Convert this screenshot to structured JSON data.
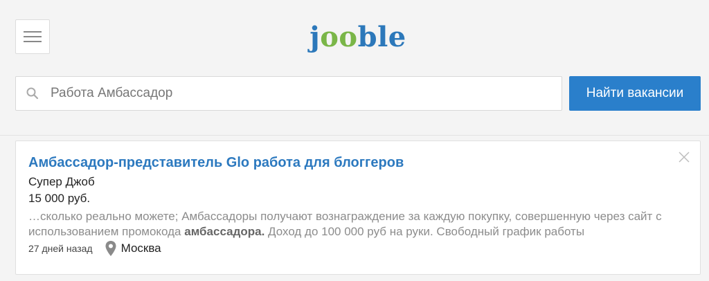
{
  "header": {
    "logo": {
      "part1": "j",
      "part2": "oo",
      "part3": "ble"
    },
    "search": {
      "value": "Работа Амбассадор",
      "placeholder": "Работа Амбассадор"
    },
    "search_button": "Найти вакансии"
  },
  "colors": {
    "brand_blue": "#2c78ba",
    "brand_green": "#7ab648",
    "button_blue": "#2a7fcb",
    "title_blue": "#2c79bf"
  },
  "icons": {
    "menu": "hamburger-menu-icon",
    "search": "search-icon",
    "close": "close-icon",
    "location": "map-pin-icon"
  },
  "job": {
    "title": "Амбассадор-представитель Glo работа для блоггеров",
    "company": "Супер Джоб",
    "salary": "15 000 руб.",
    "snippet_before": "…сколько реально можете; Амбассадоры получают вознаграждение за каждую покупку, совершенную через сайт с использованием промокода ",
    "snippet_highlight": "амбассадора.",
    "snippet_after": " Доход до 100 000 руб на руки. Свободный график работы",
    "posted": "27 дней назад",
    "location": "Москва"
  }
}
